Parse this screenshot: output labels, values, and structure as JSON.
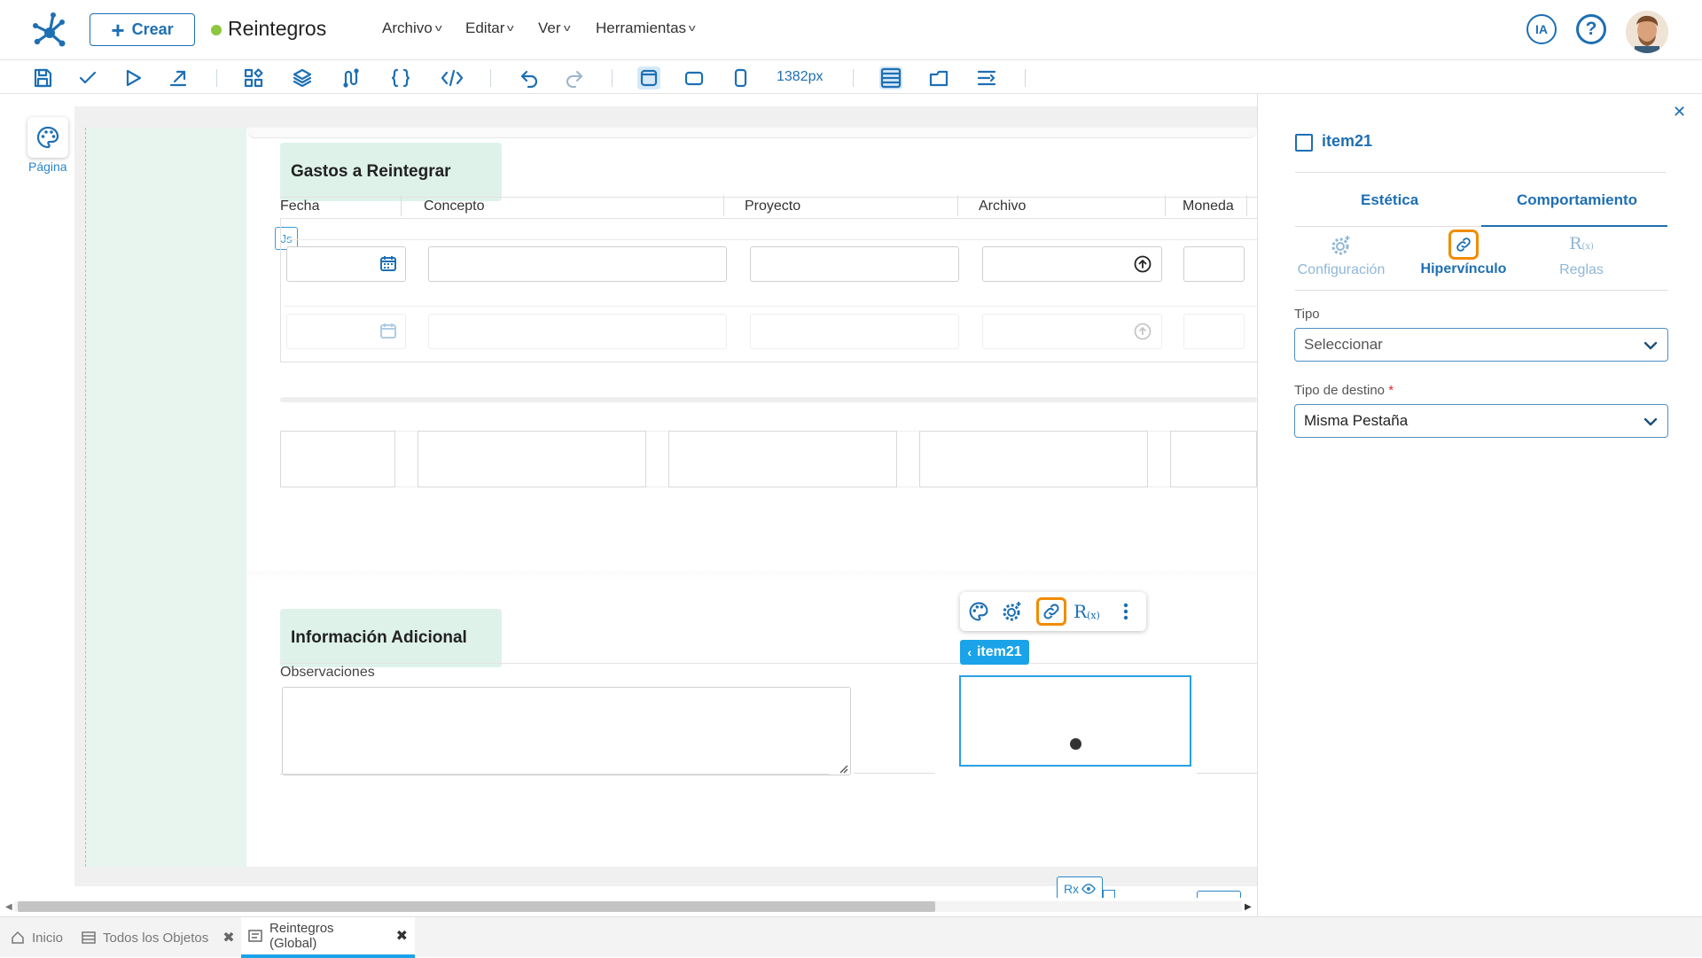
{
  "header": {
    "crear_label": "Crear",
    "app_title": "Reintegros",
    "status_color": "#8dc63f",
    "menus": [
      "Archivo",
      "Editar",
      "Ver",
      "Herramientas"
    ],
    "ai_label": "IA"
  },
  "toolbar": {
    "zoom": "1382px"
  },
  "rail": {
    "pagina_label": "Página"
  },
  "canvas": {
    "section1_title": "Gastos a Reintegrar",
    "columns": [
      "Fecha",
      "Concepto",
      "Proyecto",
      "Archivo",
      "Moneda"
    ],
    "js_badge": "Js",
    "section2_title": "Información Adicional",
    "observaciones_label": "Observaciones",
    "selected_item": "item21",
    "rx_badge": "Rx"
  },
  "panel": {
    "item_name": "item21",
    "tabs": [
      "Estética",
      "Comportamiento"
    ],
    "active_tab": "Comportamiento",
    "subtabs": [
      "Configuración",
      "Hipervínculo",
      "Reglas"
    ],
    "active_subtab": "Hipervínculo",
    "tipo_label": "Tipo",
    "tipo_value": "Seleccionar",
    "destino_label": "Tipo de destino",
    "destino_required": "*",
    "destino_value": "Misma Pestaña"
  },
  "bottom_tabs": [
    {
      "label": "Inicio"
    },
    {
      "label": "Todos los Objetos"
    },
    {
      "label": "Reintegros (Global)"
    }
  ],
  "colors": {
    "accent": "#1e6fb3",
    "selection": "#1aa3e8",
    "highlight": "#f08c00",
    "section_bg": "#def2ea"
  }
}
